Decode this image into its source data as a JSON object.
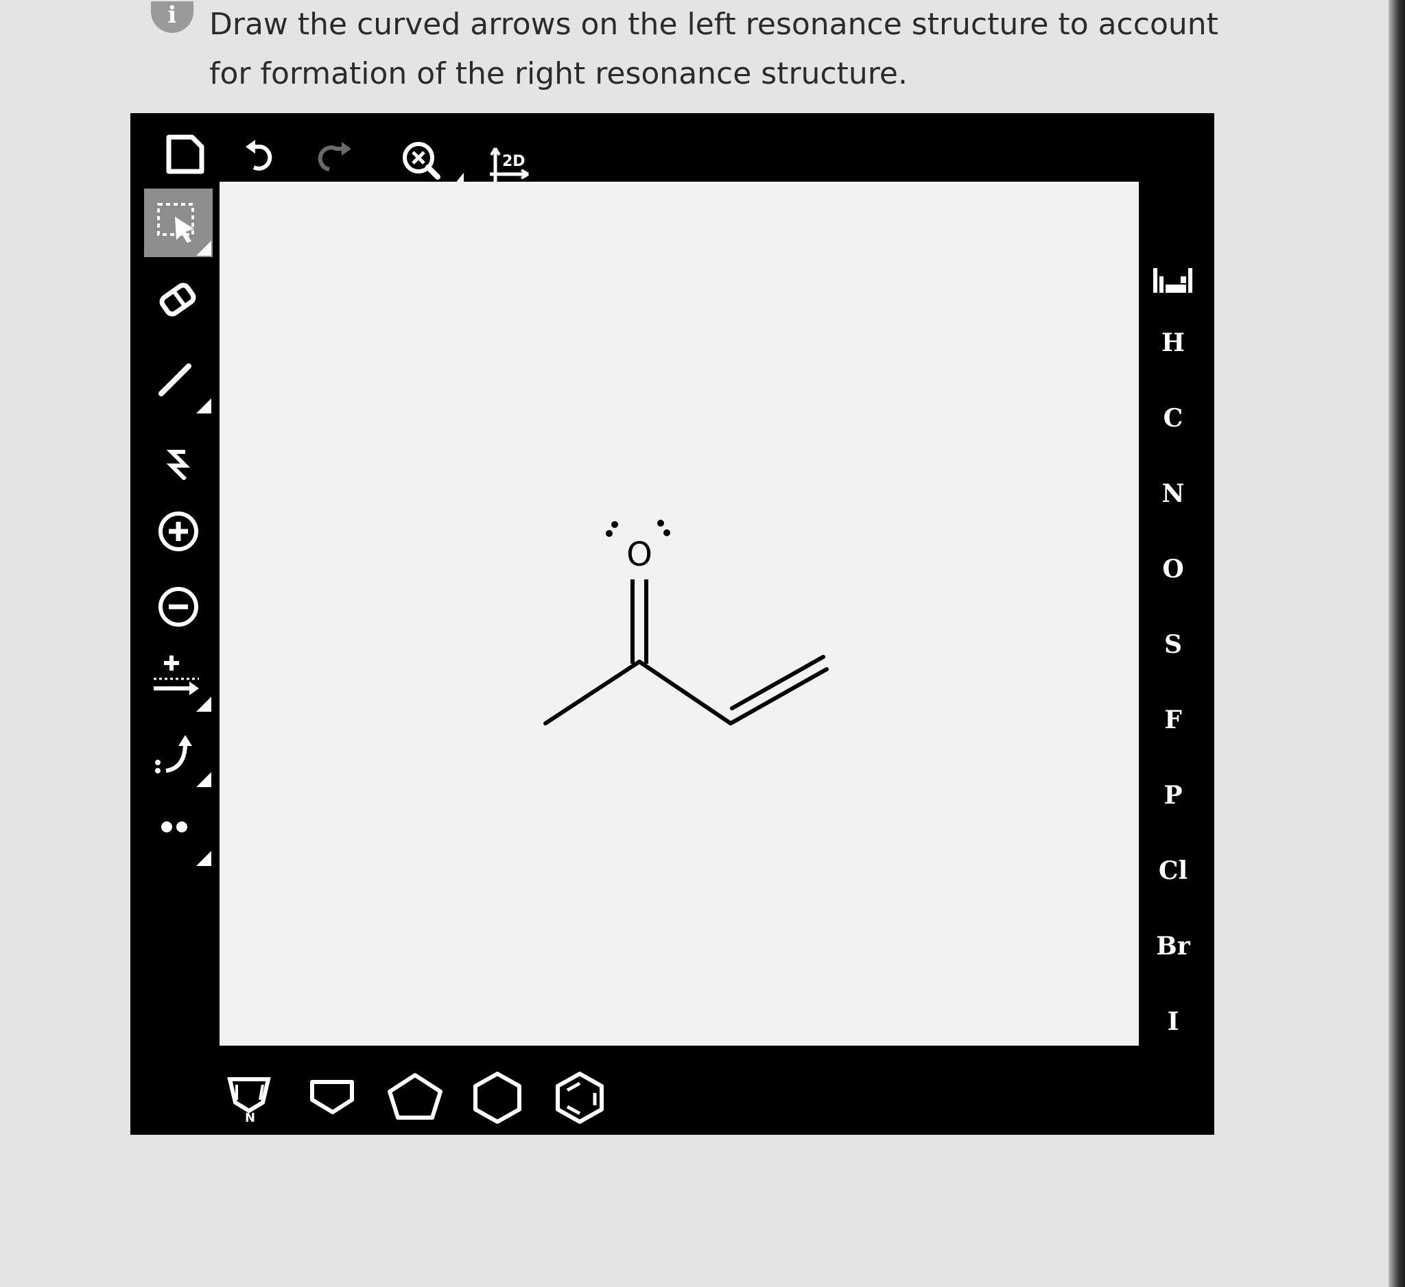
{
  "question": {
    "line1": "Draw the curved arrows on the left resonance structure to account",
    "line2": "for formation of the right resonance structure."
  },
  "info_icon_text": "i",
  "toolbar": {
    "top": [
      "new-document-icon",
      "undo-icon",
      "redo-icon",
      "zoom-icon",
      "clean-2d-icon"
    ],
    "clean_2d_label": "2D"
  },
  "side_tools": [
    "select-icon",
    "eraser-icon",
    "bond-icon",
    "chain-icon",
    "positive-charge-icon",
    "negative-charge-icon",
    "reaction-arrow-icon",
    "curved-arrow-icon",
    "lone-pair-icon"
  ],
  "elements": [
    "H",
    "C",
    "N",
    "O",
    "S",
    "F",
    "P",
    "Cl",
    "Br",
    "I"
  ],
  "rings": [
    "pyrrole-icon",
    "cyclobutane-icon",
    "cyclopentane-icon",
    "cyclohexane-icon",
    "benzene-icon"
  ],
  "molecule": {
    "atom_label": "O",
    "name_hint": "none"
  },
  "colors": {
    "editor_bg": "#000000",
    "canvas_bg": "#f2f2f2",
    "active_tool": "#8d8d8d",
    "text": "#2b2b2b"
  }
}
